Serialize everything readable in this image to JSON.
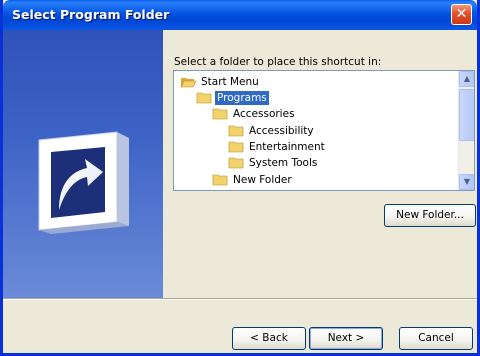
{
  "window": {
    "title": "Select Program Folder",
    "close_symbol": "✕"
  },
  "prompt": "Select a folder to place this shortcut in:",
  "tree": {
    "items": [
      {
        "label": "Start Menu",
        "selected": false
      },
      {
        "label": "Programs",
        "selected": true
      },
      {
        "label": "Accessories",
        "selected": false
      },
      {
        "label": "Accessibility",
        "selected": false
      },
      {
        "label": "Entertainment",
        "selected": false
      },
      {
        "label": "System Tools",
        "selected": false
      },
      {
        "label": "New Folder",
        "selected": false
      }
    ]
  },
  "scrollbar": {
    "up_glyph": "▲",
    "down_glyph": "▼"
  },
  "buttons": {
    "new_folder": "New Folder...",
    "back": "< Back",
    "next": "Next >",
    "cancel": "Cancel"
  },
  "colors": {
    "titlebar": "#0454e0",
    "selection": "#316ac5",
    "side_panel": "#3d63c6",
    "close_button": "#e0512a",
    "folder": "#f2d36b"
  },
  "icons": {
    "close": "close-icon",
    "folder": "folder-icon",
    "open_folder": "open-folder-icon",
    "shortcut": "shortcut-arrow-icon"
  }
}
